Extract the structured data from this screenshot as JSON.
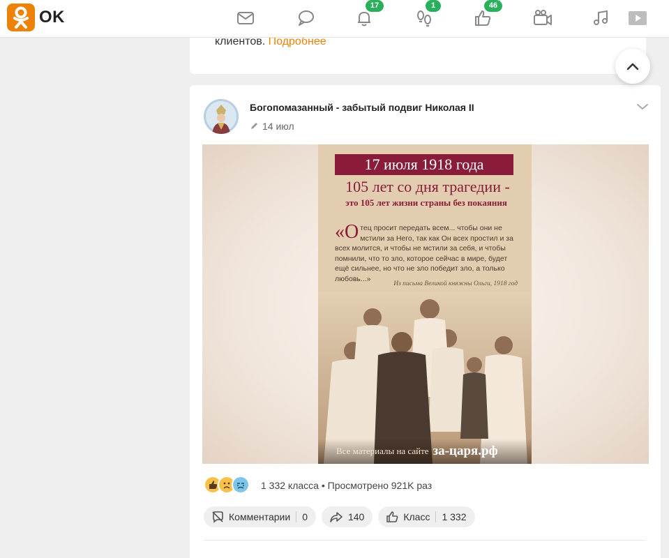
{
  "header": {
    "logo_text": "OK",
    "brand_color": "#ee8208",
    "badge_color": "#2ab05c",
    "nav": [
      {
        "name": "messages-icon",
        "badge": ""
      },
      {
        "name": "discussions-icon",
        "badge": ""
      },
      {
        "name": "notifications-icon",
        "badge": "17"
      },
      {
        "name": "guests-icon",
        "badge": "1"
      },
      {
        "name": "likes-icon",
        "badge": "46"
      },
      {
        "name": "video-icon",
        "badge": ""
      },
      {
        "name": "music-icon",
        "badge": ""
      },
      {
        "name": "video-play-icon",
        "badge": ""
      }
    ]
  },
  "top_card": {
    "text": "клиентов.",
    "link": "Подробнее"
  },
  "post": {
    "title": "Богопомазанный - забытый подвиг Николая II",
    "date": "14 июл",
    "image": {
      "date_banner": "17 июля 1918 года",
      "headline": "105 лет со дня трагедии -",
      "subheadline": "это 105 лет жизни страны без покаяния",
      "quote_first": "«О",
      "quote_rest": "тец просит передать всем... чтобы они не мстили за Него, так как Он всех простил и за всех молится, и чтобы не мстили за себя, и чтобы помнили, что то зло, которое сейчас в мире, будет ещё сильнее, но что не зло победит зло, а только любовь...»",
      "quote_source": "Из письма Великой княжны Ольги, 1918 год",
      "footer_text": "Все материалы на сайте",
      "footer_site": "за-царя.рф"
    },
    "stats": "1 332 класса • Просмотрено 921K раз",
    "actions": {
      "comments_label": "Комментарии",
      "comments_count": "0",
      "shares_count": "140",
      "like_label": "Класс",
      "like_count": "1 332"
    }
  }
}
